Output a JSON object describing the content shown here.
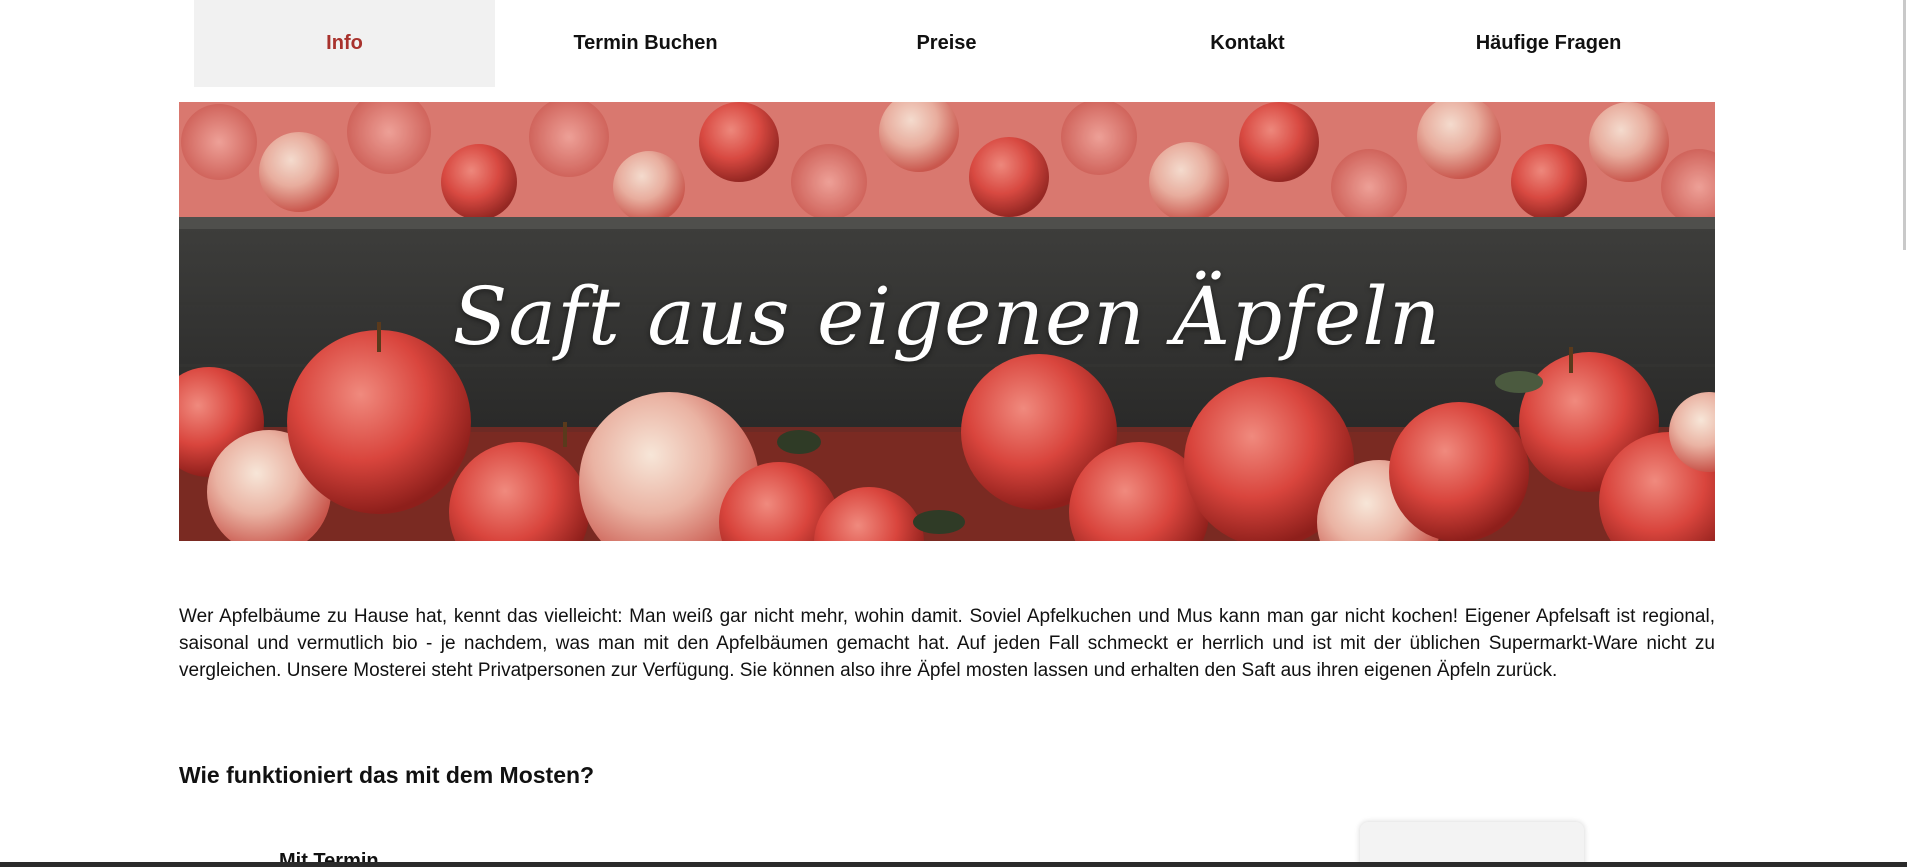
{
  "nav": {
    "items": [
      {
        "label": "Info",
        "active": true
      },
      {
        "label": "Termin Buchen",
        "active": false
      },
      {
        "label": "Preise",
        "active": false
      },
      {
        "label": "Kontakt",
        "active": false
      },
      {
        "label": "Häufige Fragen",
        "active": false
      }
    ]
  },
  "hero": {
    "title": "Saft aus eigenen Äpfeln"
  },
  "content": {
    "intro": "Wer Apfelbäume zu Hause hat, kennt das vielleicht: Man weiß gar nicht mehr, wohin damit. Soviel Apfelkuchen und Mus kann man gar nicht kochen! Eigener Apfelsaft ist regional, saisonal und vermutlich bio - je nachdem, was man mit den Apfelbäumen gemacht hat. Auf jeden Fall schmeckt er herrlich und ist mit der üblichen Supermarkt-Ware nicht zu vergleichen. Unsere Mosterei steht Privatpersonen zur Verfügung. Sie können also ihre Äpfel mosten lassen und erhalten den Saft aus ihren eigenen Äpfeln zurück.",
    "section_heading": "Wie funktioniert das mit dem Mosten?",
    "sub_heading": "Mit Termin"
  },
  "colors": {
    "accent": "#a8322d",
    "nav_active_bg": "#f1f1f1",
    "text": "#111111"
  }
}
